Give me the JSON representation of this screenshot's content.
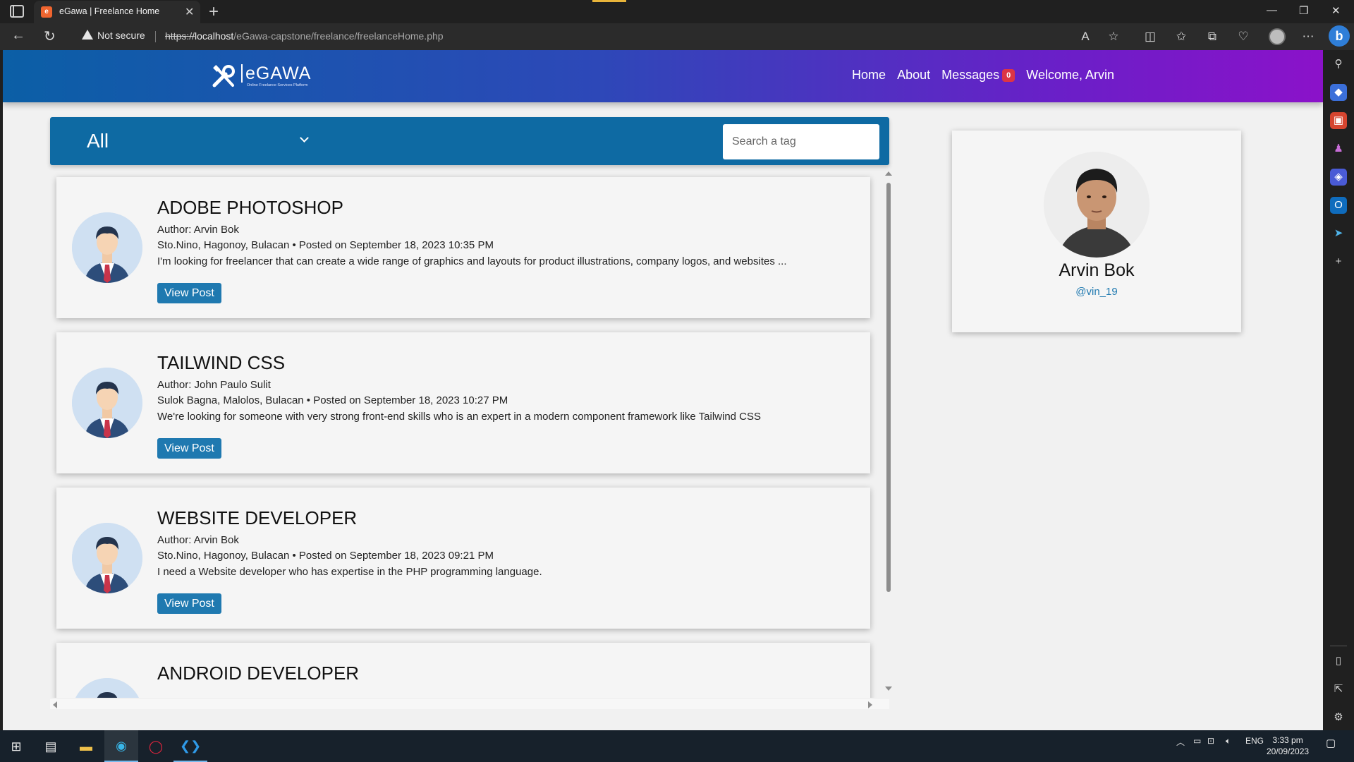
{
  "browser": {
    "tab_title": "eGawa | Freelance Home",
    "security_label": "Not secure",
    "url_scheme": "https://",
    "url_host": "localhost",
    "url_path": "/eGawa-capstone/freelance/freelanceHome.php"
  },
  "navbar": {
    "brand": "eGAWA",
    "brand_tagline": "Online Freelance Services Platform",
    "links": {
      "home": "Home",
      "about": "About",
      "messages": "Messages",
      "welcome": "Welcome, Arvin"
    },
    "message_count": "0"
  },
  "filter": {
    "selected": "All",
    "search_placeholder": "Search a tag"
  },
  "posts": [
    {
      "title": "ADOBE PHOTOSHOP",
      "author": "Author: Arvin Bok",
      "meta": "Sto.Nino, Hagonoy, Bulacan • Posted on September 18, 2023 10:35 PM",
      "description": "I'm looking for freelancer that can create a wide range of graphics and layouts for product illustrations, company logos, and websites ...",
      "button": "View Post"
    },
    {
      "title": "TAILWIND CSS",
      "author": "Author: John Paulo Sulit",
      "meta": "Sulok Bagna, Malolos, Bulacan • Posted on September 18, 2023 10:27 PM",
      "description": "We're looking for someone with very strong front-end skills who is an expert in a modern component framework like Tailwind CSS",
      "button": "View Post"
    },
    {
      "title": "WEBSITE DEVELOPER",
      "author": "Author: Arvin Bok",
      "meta": "Sto.Nino, Hagonoy, Bulacan • Posted on September 18, 2023 09:21 PM",
      "description": "I need a Website developer who has expertise in the PHP programming language.",
      "button": "View Post"
    },
    {
      "title": "ANDROID DEVELOPER"
    }
  ],
  "profile": {
    "name": "Arvin Bok",
    "handle": "@vin_19"
  },
  "taskbar": {
    "language": "ENG",
    "time": "3:33 pm",
    "date": "20/09/2023"
  },
  "colors": {
    "navbar_start": "#0b5fa6",
    "navbar_end": "#8b12c9",
    "filter_bar": "#0e6aa3",
    "button": "#1f79b0",
    "badge": "#dc3545"
  }
}
